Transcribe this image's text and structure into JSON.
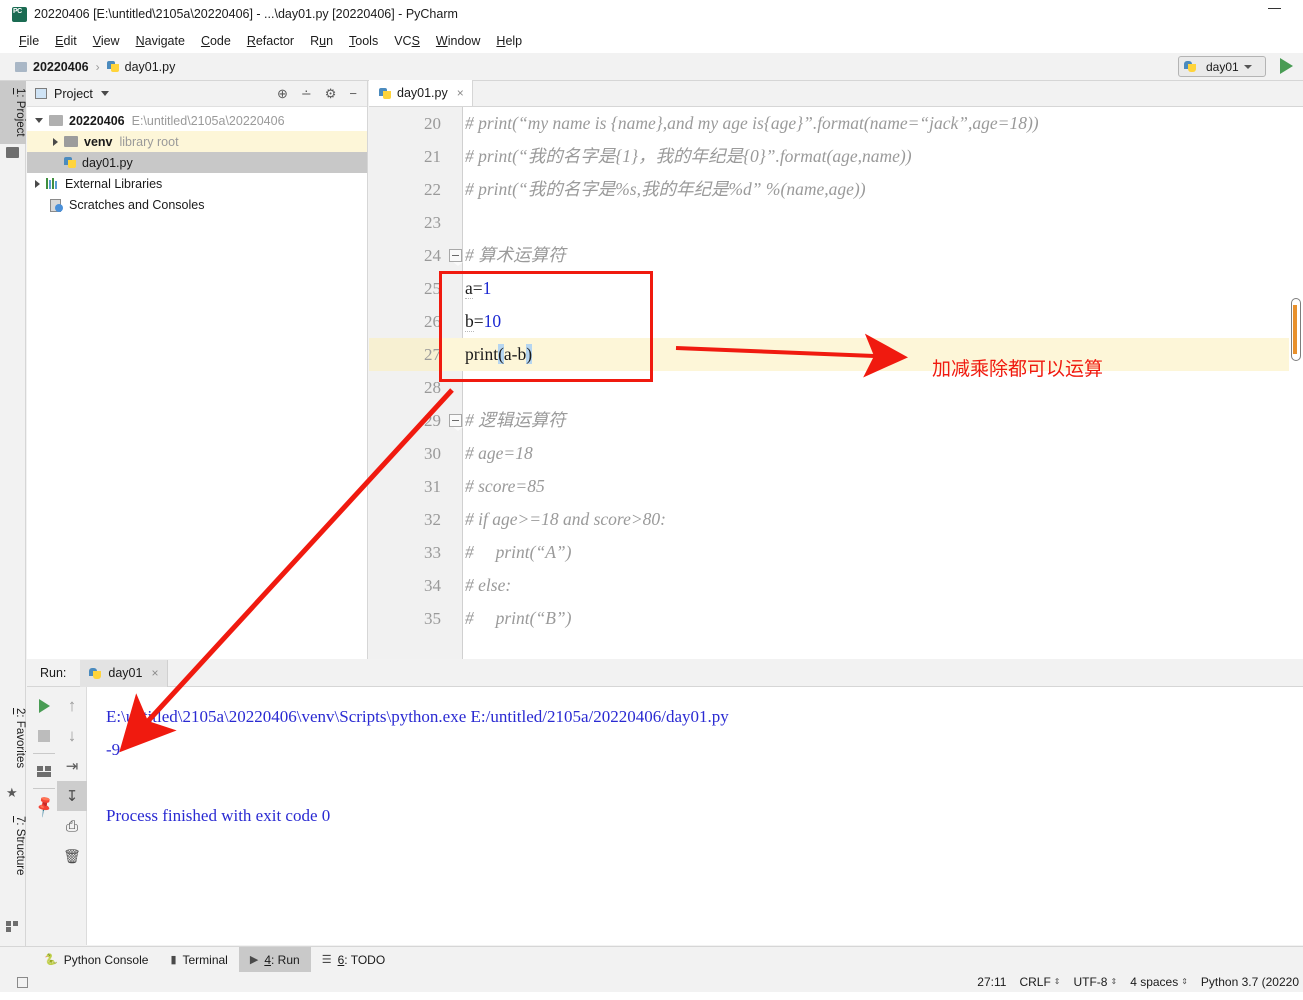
{
  "window": {
    "title": "20220406 [E:\\untitled\\2105a\\20220406] - ...\\day01.py [20220406] - PyCharm",
    "logo": "pycharm-logo",
    "minimize": "minimize-icon"
  },
  "menu": [
    {
      "label": "File",
      "accel": "F"
    },
    {
      "label": "Edit",
      "accel": "E"
    },
    {
      "label": "View",
      "accel": "V"
    },
    {
      "label": "Navigate",
      "accel": "N"
    },
    {
      "label": "Code",
      "accel": "C"
    },
    {
      "label": "Refactor",
      "accel": "R"
    },
    {
      "label": "Run",
      "accel": "u"
    },
    {
      "label": "Tools",
      "accel": "T"
    },
    {
      "label": "VCS",
      "accel": "S"
    },
    {
      "label": "Window",
      "accel": "W"
    },
    {
      "label": "Help",
      "accel": "H"
    }
  ],
  "navbar": {
    "crumb1": "20220406",
    "separator": "›",
    "crumb2": "day01.py",
    "run_config": "day01",
    "run_button": "run-icon"
  },
  "left_strip": {
    "project_tab": "1: Project",
    "favorites_tab": "2: Favorites",
    "structure_tab": "7: Structure"
  },
  "project_panel": {
    "title": "Project",
    "tools": [
      "locate-icon",
      "collapse-all-icon",
      "gear-icon",
      "hide-icon"
    ],
    "tree": [
      {
        "label": "20220406",
        "path": "E:\\untitled\\2105a\\20220406",
        "icon": "folder-icon",
        "arrow": "down",
        "bold": true,
        "state": "normal"
      },
      {
        "label": "venv",
        "path": "library root",
        "icon": "folder-icon",
        "arrow": "right",
        "bold": true,
        "state": "highlight-yellow"
      },
      {
        "label": "day01.py",
        "path": "",
        "icon": "python-file-icon",
        "arrow": "none",
        "bold": false,
        "state": "selected-gray"
      },
      {
        "label": "External Libraries",
        "path": "",
        "icon": "libraries-icon",
        "arrow": "right",
        "bold": false,
        "state": "normal"
      },
      {
        "label": "Scratches and Consoles",
        "path": "",
        "icon": "scratches-icon",
        "arrow": "none",
        "bold": false,
        "state": "normal"
      }
    ]
  },
  "editor": {
    "tab": {
      "label": "day01.py",
      "icon": "python-file-icon",
      "close": "×"
    },
    "first_line_number": 20,
    "lines": [
      {
        "n": "20",
        "text": "# print(“my name is {name},and my age is{age}”.format(name=“jack”,age=18))",
        "kind": "comment",
        "fold": false,
        "current": false
      },
      {
        "n": "21",
        "text": "# print(“我的名字是{1}，我的年纪是{0}”.format(age,name))",
        "kind": "comment",
        "fold": false,
        "current": false
      },
      {
        "n": "22",
        "text": "# print(“我的名字是%s,我的年纪是%d” %(name,age))",
        "kind": "comment",
        "fold": false,
        "current": false
      },
      {
        "n": "23",
        "text": "",
        "kind": "blank",
        "fold": false,
        "current": false
      },
      {
        "n": "24",
        "text": "# 算术运算符",
        "kind": "comment",
        "fold": true,
        "current": false
      },
      {
        "n": "25",
        "text": "a=1",
        "kind": "assign",
        "fold": false,
        "current": false
      },
      {
        "n": "26",
        "text": "b=10",
        "kind": "assign",
        "fold": false,
        "current": false
      },
      {
        "n": "27",
        "text": "print(a-b)",
        "kind": "print",
        "fold": false,
        "current": true
      },
      {
        "n": "28",
        "text": "",
        "kind": "blank",
        "fold": false,
        "current": false
      },
      {
        "n": "29",
        "text": "# 逻辑运算符",
        "kind": "comment",
        "fold": true,
        "current": false
      },
      {
        "n": "30",
        "text": "# age=18",
        "kind": "comment",
        "fold": false,
        "current": false
      },
      {
        "n": "31",
        "text": "# score=85",
        "kind": "comment",
        "fold": false,
        "current": false
      },
      {
        "n": "32",
        "text": "# if age>=18 and score>80:",
        "kind": "comment",
        "fold": false,
        "current": false
      },
      {
        "n": "33",
        "text": "#     print(“A”)",
        "kind": "comment",
        "fold": false,
        "current": false
      },
      {
        "n": "34",
        "text": "# else:",
        "kind": "comment",
        "fold": false,
        "current": false
      },
      {
        "n": "35",
        "text": "#     print(“B”)",
        "kind": "comment",
        "fold": false,
        "current": false
      }
    ],
    "code_tokens": {
      "line25": {
        "var": "a",
        "op": "=",
        "value": "1"
      },
      "line26": {
        "var": "b",
        "op": "=",
        "value": "10"
      },
      "line27": {
        "fn": "print",
        "open": "(",
        "args": "a-b",
        "close": ")"
      }
    }
  },
  "run_panel": {
    "label": "Run:",
    "tab": "day01",
    "tab_close": "×",
    "toolbar_left": [
      "rerun-icon",
      "stop-icon",
      "layout-icon",
      "pin-icon"
    ],
    "toolbar_right": [
      "up-arrow-icon",
      "down-arrow-icon",
      "soft-wrap-icon",
      "scroll-to-end-icon",
      "print-icon",
      "trash-icon"
    ],
    "console_lines": [
      "E:\\untitled\\2105a\\20220406\\venv\\Scripts\\python.exe E:/untitled/2105a/20220406/day01.py",
      "-9",
      "",
      "Process finished with exit code 0"
    ]
  },
  "bottom_tabs": [
    {
      "label": "Python Console",
      "icon": "python-console-icon",
      "accel": "",
      "active": false
    },
    {
      "label": "Terminal",
      "icon": "terminal-icon",
      "accel": "",
      "active": false
    },
    {
      "label": "4: Run",
      "icon": "run-icon",
      "accel": "4",
      "active": true
    },
    {
      "label": "6: TODO",
      "icon": "todo-icon",
      "accel": "6",
      "active": false
    }
  ],
  "status_bar": {
    "caret": "27:11",
    "line_separator": "CRLF",
    "encoding": "UTF-8",
    "indent": "4 spaces",
    "interpreter": "Python 3.7 (20220"
  },
  "annotations": {
    "arrow_label": "加减乘除都可以运算",
    "color": "#f01a0f",
    "box_target": "print-statement-block"
  }
}
